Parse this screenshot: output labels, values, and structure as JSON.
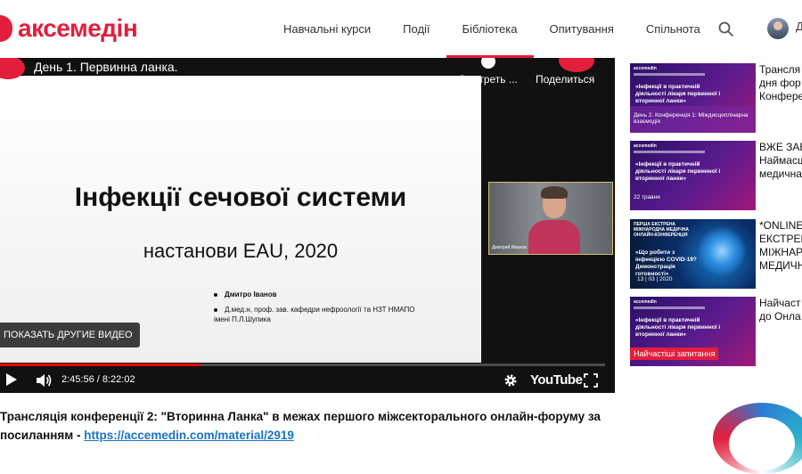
{
  "header": {
    "logo_text": "аксемедін",
    "nav": [
      "Навчальні курси",
      "Події",
      "Бібліотека",
      "Опитування",
      "Спільнота"
    ],
    "active_nav": 2,
    "account_letter": "Д"
  },
  "player": {
    "title": "День 1. Первинна ланка.",
    "watch_later": "Смотреть ...",
    "share": "Поделиться",
    "slide": {
      "title": "Інфекції сечової системи",
      "subtitle": "настанови EAU, 2020",
      "author": "Дмитро Іванов",
      "author_detail": "Д.мед.н, проф. зав. кафедри нефроології та НЗТ НМАПО імені П.Л.Шупика"
    },
    "webcam_name": "Дмитрий Иванов",
    "more_videos": "ПОКАЗАТЬ ДРУГИЕ ВИДЕО",
    "time": "2:45:56 / 8:22:02",
    "progress": 0.331,
    "youtube": "YouTube"
  },
  "caption": {
    "text": "Трансляція конференції 2: \"Вторинна Ланка\" в межах першого міжсекторального онлайн-форуму за посиланням - ",
    "link": "https://accemedin.com/material/2919"
  },
  "sidebar": {
    "cards": [
      {
        "brand": "accemedin",
        "title": "«Інфекції в практичній діяльності лікаря первинної і вторинної ланки»",
        "cta": "День 2. Конференція 1: Міждисциплінарна взаємодія",
        "text": "Трансля\nдня фор\nКонфере"
      },
      {
        "brand": "accemedin",
        "title": "«Інфекції в практичній діяльності лікаря первинної і вторинної ланки»",
        "cta": "22 травня",
        "text": "ВЖЕ ЗАВ\nНаймасш\nмедична"
      },
      {
        "brand": "ПЕРША ЕКСТРЕНА МІЖНАРОДНА МЕДИЧНА ОНЛАЙН-КОНФЕРЕНЦІЯ",
        "title": "«Що робити з інфекцією COVID-19? Демонстрація готовності»",
        "cta": "13 | 03 | 2020",
        "text": "*ONLINE\nЕКСТРЕН\nМІЖНАР\nМЕДИЧН"
      },
      {
        "brand": "accemedin",
        "title": "«Інфекції в практичній діяльності лікаря первинної і вторинної ланки»",
        "tag": "Найчастіші запитання",
        "text": "Найчаст\nдо Онла"
      }
    ]
  },
  "colors": {
    "brand_red": "#e31e3c",
    "link_blue": "#1a73c8",
    "progress_red": "#ff0000"
  }
}
